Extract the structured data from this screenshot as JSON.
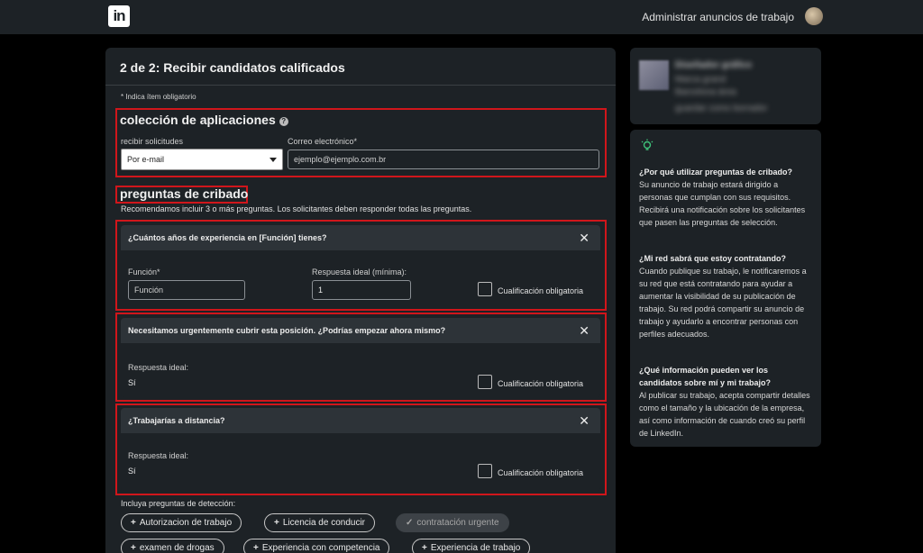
{
  "header": {
    "logo": "in",
    "manage_link": "Administrar anuncios de trabajo"
  },
  "main": {
    "title": "2 de 2: Recibir candidatos calificados",
    "required_note": "* Indica ítem obligatorio",
    "collection": {
      "title": "colección de aplicaciones",
      "receive_label": "recibir solicitudes",
      "receive_value": "Por e-mail",
      "email_label": "Correo electrónico*",
      "email_placeholder": "ejemplo@ejemplo.com.br"
    },
    "screening": {
      "title": "preguntas de cribado",
      "recommendation": "Recomendamos incluir 3 o más preguntas. Los solicitantes deben responder todas las preguntas."
    },
    "questions": [
      {
        "text": "¿Cuántos años de experiencia en [Función] tienes?",
        "function_label": "Función*",
        "function_placeholder": "Función",
        "ideal_label": "Respuesta ideal (mínima):",
        "ideal_value": "1",
        "qualification_label": "Cualificación obligatoria"
      },
      {
        "text": "Necesitamos urgentemente cubrir esta posición. ¿Podrías empezar ahora mismo?",
        "ideal_label": "Respuesta ideal:",
        "ideal_value": "Sí",
        "qualification_label": "Cualificación obligatoria"
      },
      {
        "text": "¿Trabajarías a distancia?",
        "ideal_label": "Respuesta ideal:",
        "ideal_value": "Sí",
        "qualification_label": "Cualificación obligatoria"
      }
    ],
    "include_text": "Incluya preguntas de detección:",
    "pills": [
      {
        "label": "Autorizacion de trabajo",
        "state": "add"
      },
      {
        "label": "Licencia de conducir",
        "state": "add"
      },
      {
        "label": "contratación urgente",
        "state": "selected"
      },
      {
        "label": "examen de drogas",
        "state": "add"
      },
      {
        "label": "Experiencia con competencia",
        "state": "add"
      },
      {
        "label": "Experiencia de trabajo",
        "state": "add"
      }
    ]
  },
  "sidebar": {
    "company_name": "Diseñador gráfico",
    "company_line1": "Marca grand",
    "company_line2": "Barcelona área",
    "company_line3": "guardar como borrador",
    "tips": [
      {
        "question": "¿Por qué utilizar preguntas de cribado?",
        "answer": "Su anuncio de trabajo estará dirigido a personas que cumplan con sus requisitos. Recibirá una notificación sobre los solicitantes que pasen las preguntas de selección."
      },
      {
        "question": "¿Mi red sabrá que estoy contratando?",
        "answer": "Cuando publique su trabajo, le notificaremos a su red que está contratando para ayudar a aumentar la visibilidad de su publicación de trabajo. Su red podrá compartir su anuncio de trabajo y ayudarlo a encontrar personas con perfiles adecuados."
      },
      {
        "question": "¿Qué información pueden ver los candidatos sobre mí y mi trabajo?",
        "answer": "Al publicar su trabajo, acepta compartir detalles como el tamaño y la ubicación de la empresa, así como información de cuando creó su perfil de LinkedIn."
      }
    ]
  },
  "colors": {
    "page_bg": "#000000",
    "panel_bg": "#1d2226",
    "highlight": "#d0161b",
    "tip_icon": "#3ec27a"
  }
}
